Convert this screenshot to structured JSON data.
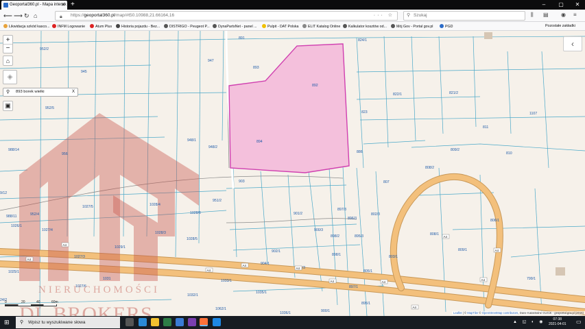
{
  "browser": {
    "tab_title": "Geoportal360.pl - Mapa interak",
    "new_tab_label": "+",
    "url_prefix": "https://",
    "url_main": "geoportal360.pl",
    "url_rest": "/map/#t50.10988,21.66164,16",
    "search_placeholder": "Szukaj",
    "window_controls": [
      "–",
      "▢",
      "✕"
    ],
    "bookmarks": [
      {
        "label": "Likwidacja szkód kasco...",
        "color": "#e8a33c"
      },
      {
        "label": "INFM Logowanie",
        "color": "#333"
      },
      {
        "label": "Atum Plus",
        "color": "#d22"
      },
      {
        "label": "Historia pojazdu - Bez...",
        "color": "#444"
      },
      {
        "label": "DISTRIGO - Peugeot P...",
        "color": "#555"
      },
      {
        "label": "DynaPartsNet - panel ...",
        "color": "#555"
      },
      {
        "label": "Pulpit - DAT Polska",
        "color": "#f0c000"
      },
      {
        "label": "ELIT Katalog Online",
        "color": "#888"
      },
      {
        "label": "Kalkulator kosztów od...",
        "color": "#555"
      },
      {
        "label": "Mój Gov - Portal gov.pl",
        "color": "#555"
      },
      {
        "label": "PGD",
        "color": "#2a6bc8"
      }
    ],
    "other_bookmarks": "Pozostałe zakładki"
  },
  "map": {
    "search_value": "893 borek wielki",
    "zoom_in": "+",
    "zoom_out": "−",
    "panel_toggle": "‹",
    "scale_labels": [
      "0",
      "20",
      "40",
      "60m"
    ],
    "attribution_parts": [
      {
        "text": "Leaflet",
        "link": true
      },
      {
        "text": " | © ",
        "link": false
      },
      {
        "text": "MapTiler",
        "link": true
      },
      {
        "text": " © ",
        "link": false
      },
      {
        "text": "OpenStreetMap contributors",
        "link": true
      },
      {
        "text": ", Dane Katastralne GUGiK - geoportal.gov.pl (2015)",
        "link": false
      }
    ],
    "highlight_color": "#f4c0dc",
    "highlight_border": "#d040b0",
    "road_color": "#f3c07c",
    "parcel_line_color": "#4aa8c8",
    "parcel_label_color": "#1e5aa8",
    "parcel_labels": [
      "891",
      "952/2",
      "947",
      "945",
      "893",
      "824/1",
      "892",
      "952/5",
      "822/1",
      "821/2",
      "823",
      "811",
      "1107",
      "988/14",
      "956",
      "948/1",
      "948/2",
      "894",
      "886",
      "809/2",
      "810",
      "808/2",
      "903",
      "807",
      "9/12",
      "951/2",
      "1028/4",
      "952/4",
      "1027/5",
      "1028/6",
      "897/3",
      "901/2",
      "802/3",
      "988/11",
      "1026/1",
      "1027/4",
      "896/3",
      "1028/5",
      "900/3",
      "898/2",
      "895/3",
      "806/1",
      "808/1",
      "1029/1",
      "1028/3",
      "902/1",
      "898/1",
      "803/1",
      "809/1",
      "1027/3",
      "904/1",
      "901/3",
      "1025/1",
      "1031",
      "805/1",
      "1033/1",
      "799/1",
      "1027/6",
      "1032/1",
      "897/1",
      "1035/1",
      "24/2",
      "1062/1",
      "895/1",
      "1036/1",
      "900/1",
      "805/2"
    ],
    "road_labels": [
      "A4",
      "A4",
      "A4",
      "A4",
      "A4",
      "A4",
      "A4",
      "A4",
      "A4",
      "A4",
      "A4"
    ],
    "watermark": {
      "line1": "NIERUCHOMOŚCI",
      "line2": "DL BROKERS",
      "color": "rgba(190,80,70,0.45)"
    }
  },
  "taskbar": {
    "search_text": "Wpisz tu wyszukiwane słowa",
    "time": "07:38",
    "date": "2021-04-01",
    "tray_icons": "▲ ◱ ◐ ◉"
  }
}
